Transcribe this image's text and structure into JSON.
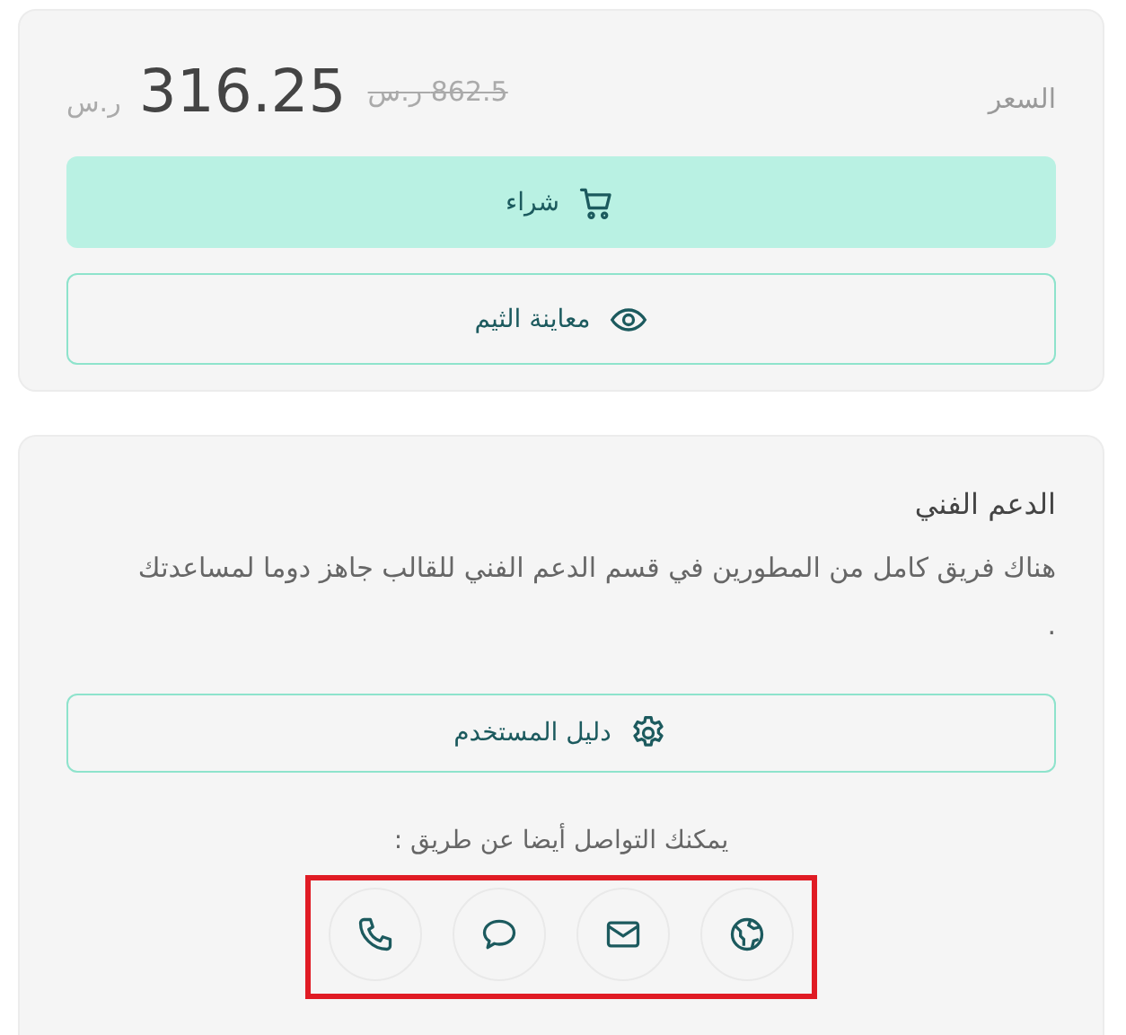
{
  "price": {
    "label": "السعر",
    "old": "862.5 ر.س",
    "current": "316.25",
    "currency": "ر.س"
  },
  "actions": [
    {
      "kind": "buy",
      "label": "شراء"
    },
    {
      "kind": "preview",
      "label": "معاينة الثيم"
    }
  ],
  "support": {
    "title": "الدعم الفني",
    "text": "هناك فريق كامل من المطورين في قسم الدعم الفني للقالب جاهز دوما لمساعدتك .",
    "guide": {
      "kind": "settings",
      "label": "دليل المستخدم"
    },
    "contact_label": "يمكنك التواصل أيضا عن طريق :",
    "contacts": [
      {
        "kind": "website"
      },
      {
        "kind": "email"
      },
      {
        "kind": "chat"
      },
      {
        "kind": "phone"
      }
    ],
    "highlighted": true
  }
}
